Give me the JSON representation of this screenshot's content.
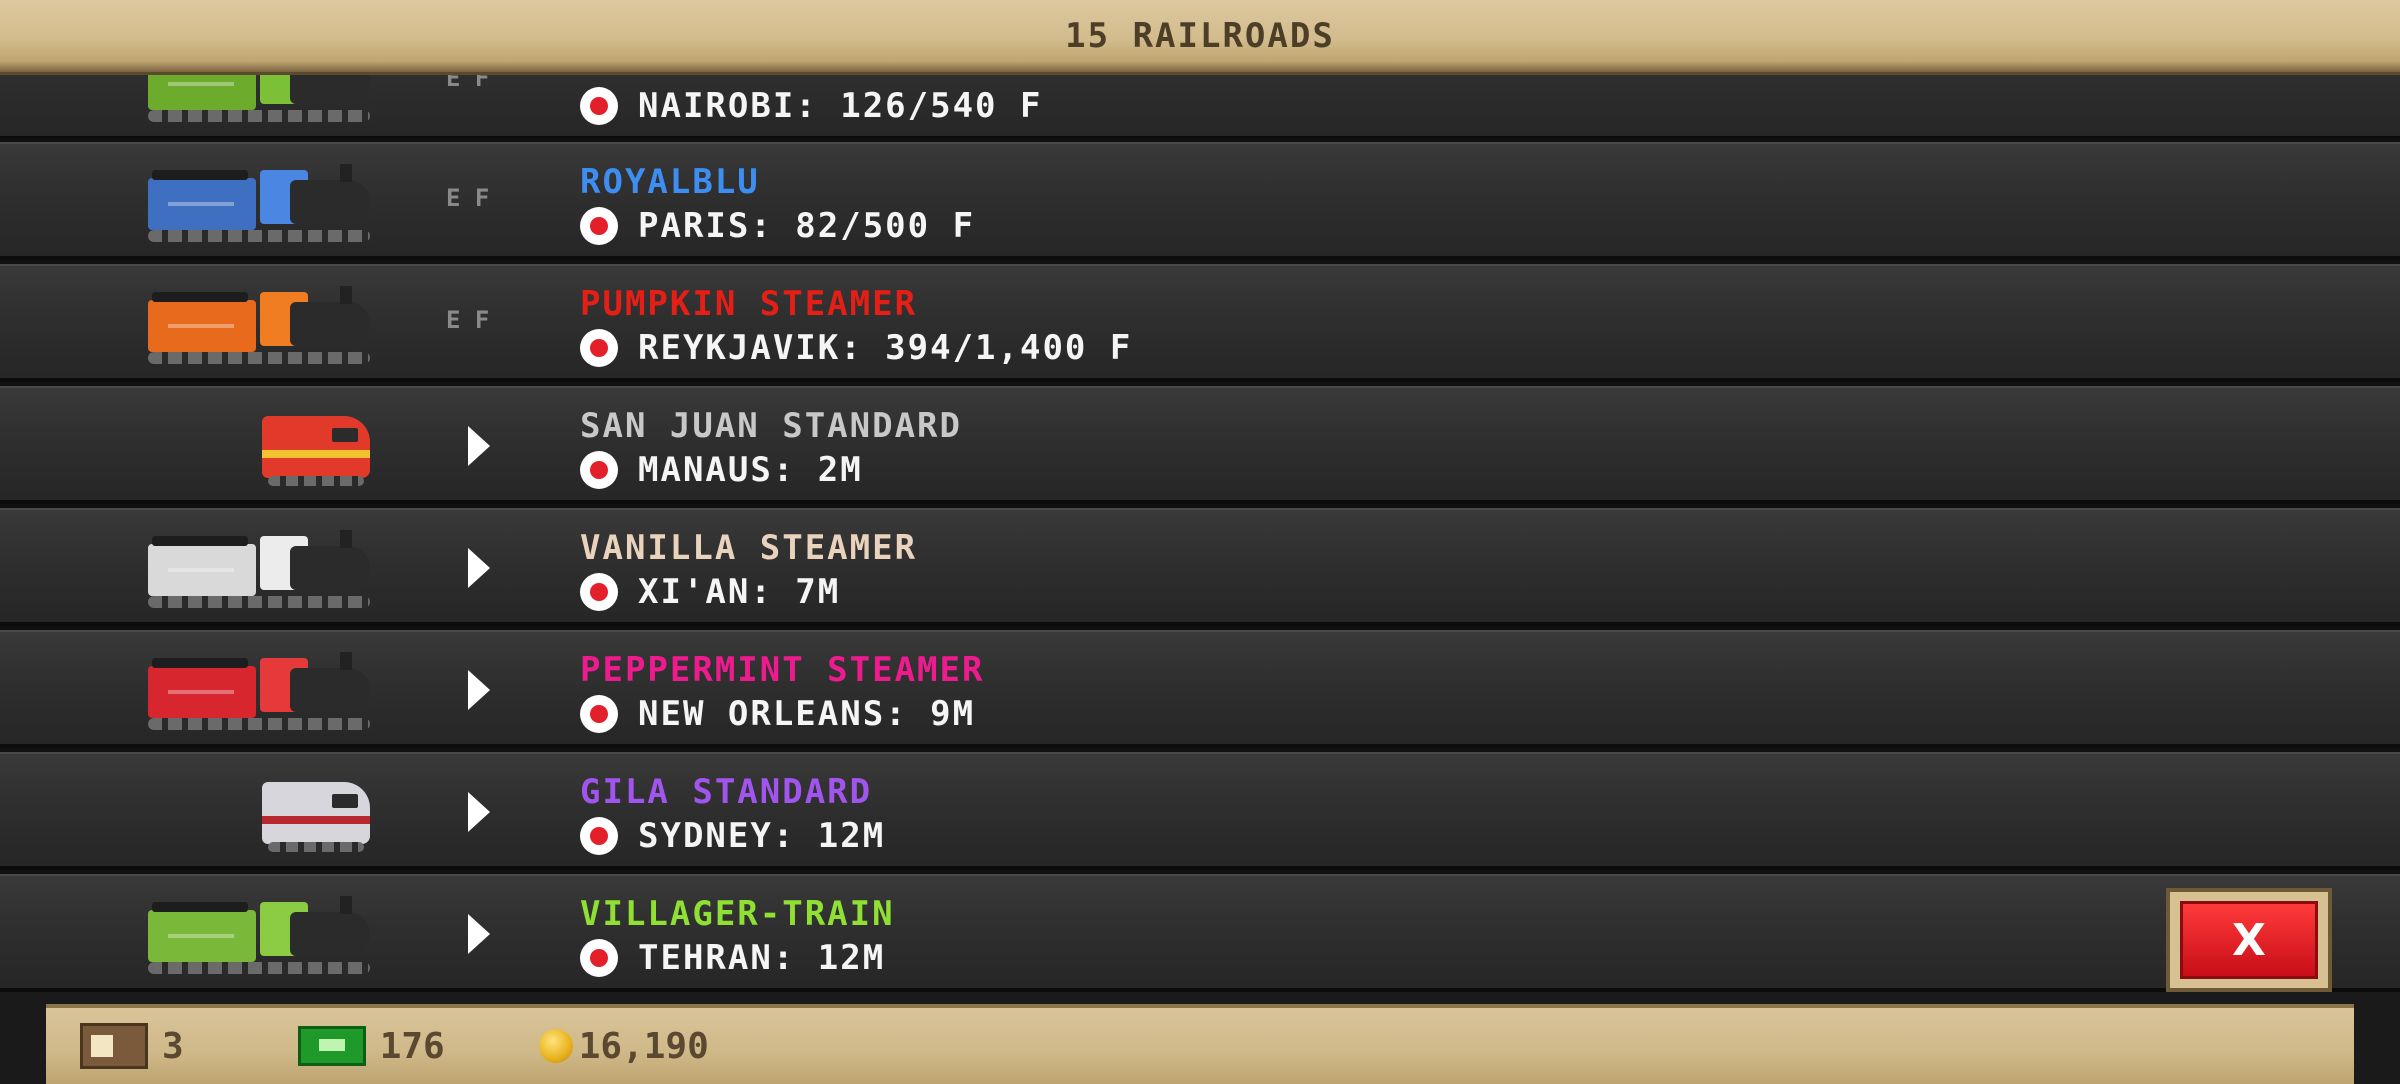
{
  "header": {
    "title": "15 RAILROADS"
  },
  "colors": {
    "royalblu": "#3d8ef2",
    "pumpkin": "#e51e16",
    "sanjuan": "#c8c8c8",
    "vanilla": "#ead3bd",
    "peppermint": "#ee1b8f",
    "gila": "#a255ee",
    "villager": "#8fe033",
    "close_button": "#e3202a"
  },
  "trains": [
    {
      "name": "",
      "destination": "NAIROBI: 126/540 F",
      "status": "fuel",
      "status_label": "E F",
      "sprite": "green-steam-locomotive"
    },
    {
      "name": "ROYALBLU",
      "destination": "PARIS: 82/500 F",
      "status": "fuel",
      "status_label": "E F",
      "sprite": "blue-steam-locomotive"
    },
    {
      "name": "PUMPKIN STEAMER",
      "destination": "REYKJAVIK: 394/1,400 F",
      "status": "fuel",
      "status_label": "E F",
      "sprite": "orange-pumpkin-locomotive"
    },
    {
      "name": "SAN JUAN STANDARD",
      "destination": "MANAUS: 2M",
      "status": "play",
      "sprite": "red-diesel-locomotive"
    },
    {
      "name": "VANILLA STEAMER",
      "destination": "XI'AN: 7M",
      "status": "play",
      "sprite": "white-steam-locomotive"
    },
    {
      "name": "PEPPERMINT STEAMER",
      "destination": "NEW ORLEANS: 9M",
      "status": "play",
      "sprite": "red-peppermint-locomotive"
    },
    {
      "name": "GILA STANDARD",
      "destination": "SYDNEY: 12M",
      "status": "play",
      "sprite": "silver-diesel-locomotive"
    },
    {
      "name": "VILLAGER-TRAIN",
      "destination": "TEHRAN: 12M",
      "status": "play",
      "sprite": "green-steam-locomotive"
    }
  ],
  "close_button": {
    "label": "X"
  },
  "footer": {
    "crates": "3",
    "bux": "176",
    "coins": "16,190"
  }
}
